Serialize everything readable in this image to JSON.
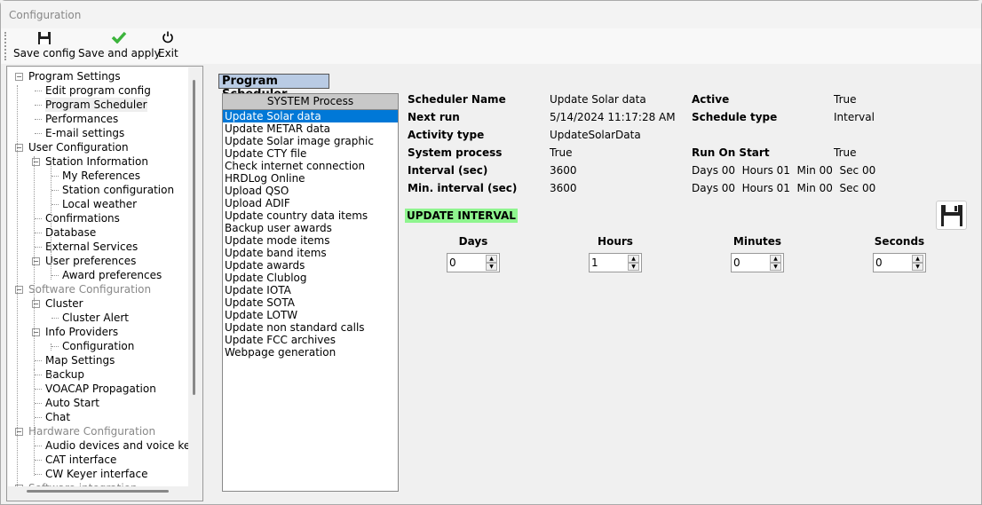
{
  "window": {
    "title": "Configuration"
  },
  "toolbar": [
    {
      "label": "Save config",
      "icon": "floppy-icon"
    },
    {
      "label": "Save and apply",
      "icon": "checkmark-icon"
    },
    {
      "label": "Exit",
      "icon": "power-icon"
    }
  ],
  "tree": [
    {
      "label": "Program Settings",
      "level": 0,
      "expander": true
    },
    {
      "label": "Edit program config",
      "level": 1
    },
    {
      "label": "Program Scheduler",
      "level": 1,
      "selected": true
    },
    {
      "label": "Performances",
      "level": 1
    },
    {
      "label": "E-mail settings",
      "level": 1
    },
    {
      "label": "User Configuration",
      "level": 0,
      "expander": true
    },
    {
      "label": "Station Information",
      "level": 1,
      "expander": true
    },
    {
      "label": "My References",
      "level": 2
    },
    {
      "label": "Station configuration",
      "level": 2
    },
    {
      "label": "Local weather",
      "level": 2
    },
    {
      "label": "Confirmations",
      "level": 1
    },
    {
      "label": "Database",
      "level": 1
    },
    {
      "label": "External Services",
      "level": 1
    },
    {
      "label": "User preferences",
      "level": 1,
      "expander": true
    },
    {
      "label": "Award preferences",
      "level": 2
    },
    {
      "label": "Software Configuration",
      "level": 0,
      "expander": true,
      "gray": true
    },
    {
      "label": "Cluster",
      "level": 1,
      "expander": true
    },
    {
      "label": "Cluster Alert",
      "level": 2
    },
    {
      "label": "Info Providers",
      "level": 1,
      "expander": true
    },
    {
      "label": "Configuration",
      "level": 2
    },
    {
      "label": "Map Settings",
      "level": 1
    },
    {
      "label": "Backup",
      "level": 1
    },
    {
      "label": "VOACAP Propagation",
      "level": 1
    },
    {
      "label": "Auto Start",
      "level": 1
    },
    {
      "label": "Chat",
      "level": 1
    },
    {
      "label": "Hardware Configuration",
      "level": 0,
      "expander": true,
      "gray": true
    },
    {
      "label": "Audio devices and voice keyer",
      "level": 1
    },
    {
      "label": "CAT interface",
      "level": 1
    },
    {
      "label": "CW Keyer interface",
      "level": 1
    },
    {
      "label": "Software integration",
      "level": 0,
      "expander": true,
      "gray": true
    }
  ],
  "section_title": "Program Scheduler",
  "process_list": {
    "header": "SYSTEM Process",
    "selected_index": 0,
    "items": [
      "Update Solar data",
      "Update METAR data",
      "Update Solar image graphic",
      "Update CTY file",
      "Check internet connection",
      "HRDLog Online",
      "Upload QSO",
      "Upload ADIF",
      "Update country data items",
      "Backup user awards",
      "Update mode items",
      "Update band items",
      "Update awards",
      "Update Clublog",
      "Update IOTA",
      "Update SOTA",
      "Update LOTW",
      "Update non standard calls",
      "Update FCC archives",
      "Webpage generation"
    ]
  },
  "details": {
    "scheduler_name": {
      "label": "Scheduler Name",
      "value": "Update Solar data"
    },
    "next_run": {
      "label": "Next run",
      "value": "5/14/2024 11:17:28 AM"
    },
    "activity_type": {
      "label": "Activity type",
      "value": "UpdateSolarData"
    },
    "system_process": {
      "label": "System process",
      "value": "True"
    },
    "interval": {
      "label": "Interval  (sec)",
      "value": "3600",
      "breakdown": "Days 00  Hours 01  Min 00  Sec 00"
    },
    "min_interval": {
      "label": "Min. interval  (sec)",
      "value": "3600",
      "breakdown": "Days 00  Hours 01  Min 00  Sec 00"
    },
    "active": {
      "label": "Active",
      "value": "True"
    },
    "schedule_type": {
      "label": "Schedule type",
      "value": "Interval"
    },
    "run_on_start": {
      "label": "Run On Start",
      "value": "True"
    }
  },
  "update_interval": {
    "title": "UPDATE INTERVAL",
    "accent": "#8ff58f",
    "fields": [
      {
        "label": "Days",
        "value": "0"
      },
      {
        "label": "Hours",
        "value": "1"
      },
      {
        "label": "Minutes",
        "value": "0"
      },
      {
        "label": "Seconds",
        "value": "0"
      }
    ]
  }
}
